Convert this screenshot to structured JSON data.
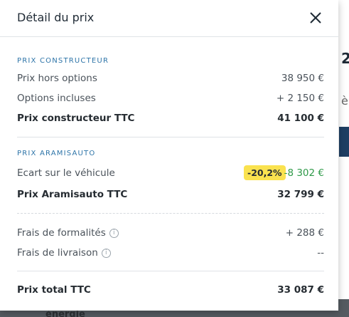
{
  "modal": {
    "title": "Détail du prix"
  },
  "sections": {
    "constructeur": {
      "label": "PRIX CONSTRUCTEUR",
      "hors_options_label": "Prix hors options",
      "hors_options_value": "38 950 €",
      "options_label": "Options incluses",
      "options_value": "+ 2 150 €",
      "total_label": "Prix constructeur TTC",
      "total_value": "41 100 €"
    },
    "aramisauto": {
      "label": "PRIX ARAMISAUTO",
      "ecart_label": "Ecart sur le véhicule",
      "ecart_badge": "-20,2%",
      "ecart_value": "-8 302 €",
      "total_label": "Prix Aramisauto TTC",
      "total_value": "32 799 €"
    },
    "frais": {
      "formalites_label": "Frais de formalités",
      "formalites_value": "+ 288 €",
      "livraison_label": "Frais de livraison",
      "livraison_value": "--"
    },
    "final": {
      "label": "Prix total TTC",
      "value": "33 087 €"
    }
  },
  "background": {
    "heading_fragment": "2",
    "text_fragment": "è",
    "bottom_fragment": "énergie"
  },
  "colors": {
    "accent": "#2d74a8",
    "badge": "#fae24f",
    "discount": "#2e9948"
  }
}
